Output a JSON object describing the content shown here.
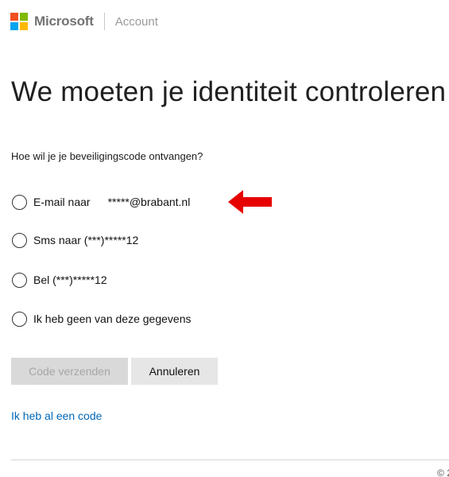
{
  "header": {
    "brand": "Microsoft",
    "section": "Account",
    "logo_colors": [
      "#f25022",
      "#7fba00",
      "#00a4ef",
      "#ffb900"
    ]
  },
  "title": "We moeten je identiteit controleren",
  "question": "Hoe wil je je beveiligingscode ontvangen?",
  "options": [
    {
      "label": "E-mail naar",
      "value": "*****@brabant.nl",
      "selected": false
    },
    {
      "label": "Sms naar (***)*****12",
      "selected": false
    },
    {
      "label": "Bel (***)*****12",
      "selected": false
    },
    {
      "label": "Ik heb geen van deze gegevens",
      "selected": false
    }
  ],
  "annotation": {
    "icon": "red-arrow-left-icon",
    "color": "#e60000"
  },
  "buttons": {
    "send_label": "Code verzenden",
    "send_disabled": true,
    "cancel_label": "Annuleren"
  },
  "link": "Ik heb al een code",
  "footer": {
    "copyright": "© 2"
  }
}
